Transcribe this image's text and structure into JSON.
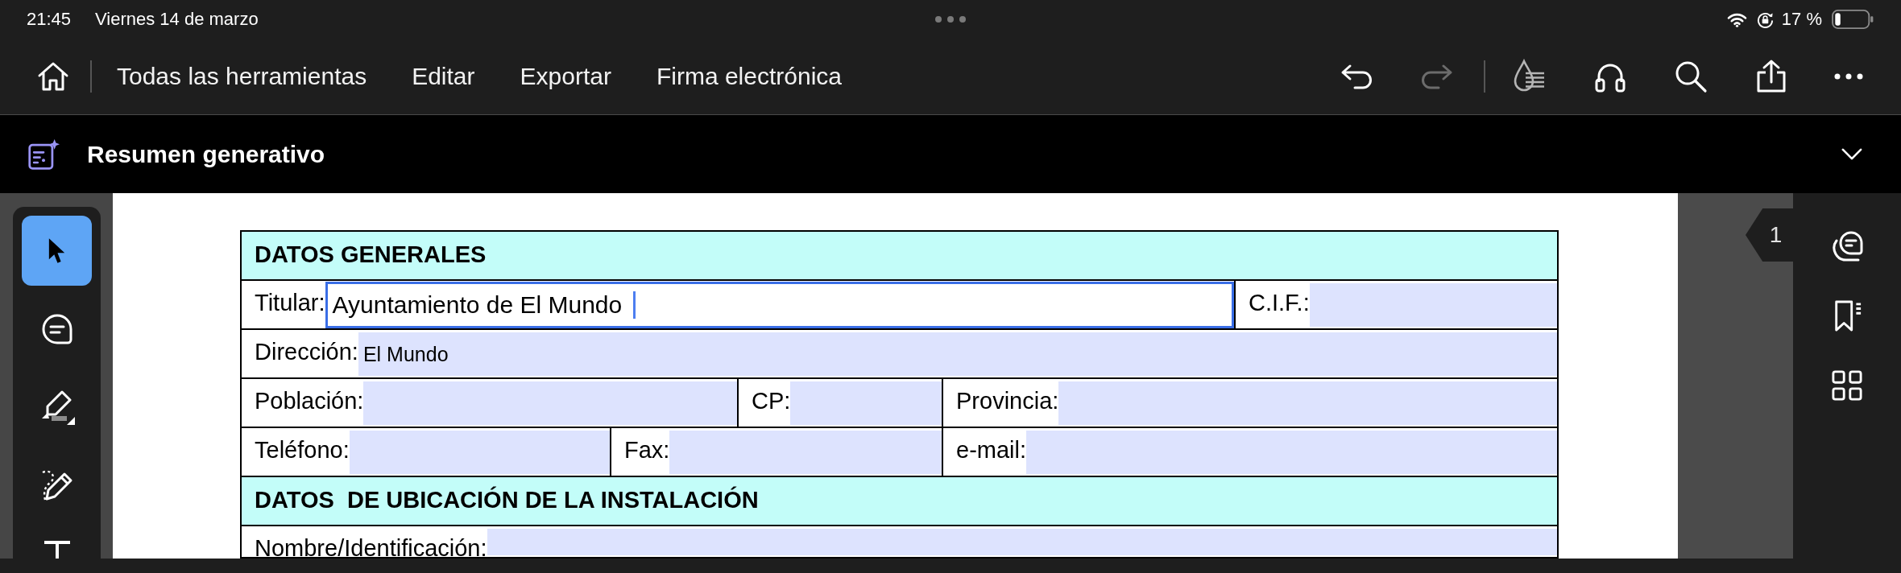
{
  "status_bar": {
    "time": "21:45",
    "date": "Viernes 14 de marzo",
    "battery": "17 %"
  },
  "toolbar": {
    "menu": [
      "Todas las herramientas",
      "Editar",
      "Exportar",
      "Firma electrónica"
    ],
    "actions": [
      {
        "kind": "undo",
        "disabled": false
      },
      {
        "kind": "redo",
        "disabled": true
      },
      {
        "kind": "liquid-mode",
        "disabled": false
      },
      {
        "kind": "listen",
        "disabled": false
      },
      {
        "kind": "search",
        "disabled": false
      },
      {
        "kind": "share",
        "disabled": false
      },
      {
        "kind": "more",
        "disabled": false
      }
    ]
  },
  "summary_bar": {
    "title": "Resumen generativo",
    "expanded": false
  },
  "tools": [
    {
      "kind": "select",
      "selected": true
    },
    {
      "kind": "comment",
      "selected": false
    },
    {
      "kind": "highlight",
      "selected": false
    },
    {
      "kind": "draw",
      "selected": false
    },
    {
      "kind": "text",
      "selected": false
    }
  ],
  "form": {
    "sections": [
      {
        "title": "DATOS GENERALES",
        "rows": [
          [
            {
              "label": "Titular:",
              "value": "Ayuntamiento de El Mundo",
              "focused": true
            },
            {
              "label": "C.I.F.:",
              "focused": false
            }
          ],
          [
            {
              "label": "Dirección:",
              "value": "El Mundo",
              "focused": false
            }
          ],
          [
            {
              "label": "Población:",
              "focused": false
            },
            {
              "label": "CP:",
              "focused": false
            },
            {
              "label": "Provincia:",
              "focused": false
            }
          ],
          [
            {
              "label": "Teléfono:",
              "focused": false
            },
            {
              "label": "Fax:",
              "focused": false
            },
            {
              "label": "e-mail:",
              "focused": false
            }
          ]
        ]
      },
      {
        "title": "DATOS  DE UBICACIÓN DE LA INSTALACIÓN",
        "rows": [
          [
            {
              "label": "Nombre/Identificación:",
              "focused": false
            }
          ]
        ]
      }
    ]
  },
  "page_number": "1"
}
